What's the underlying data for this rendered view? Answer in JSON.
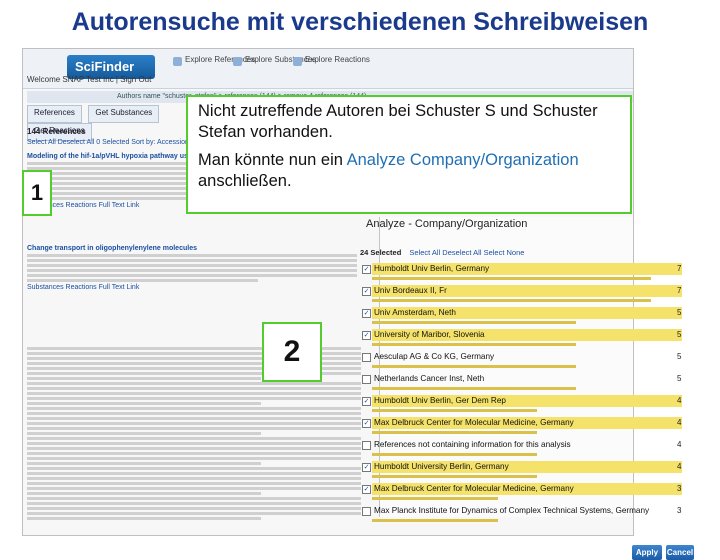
{
  "slide": {
    "title": "Autorensuche mit verschiedenen Schreibweisen"
  },
  "app": {
    "logo": "SciFinder",
    "nav": [
      {
        "icon": "references-icon",
        "label": "Explore References"
      },
      {
        "icon": "substances-icon",
        "label": "Explore Substances"
      },
      {
        "icon": "reactions-icon",
        "label": "Explore Reactions"
      }
    ],
    "welcome": "Welcome SNAP Test Inc | Sign Out",
    "breadcrumb": "Authors name \"schuster, stefan\" > references (144) > remove 4 references (144)",
    "tabs": [
      "References",
      "Get Substances",
      "Get Reactions"
    ],
    "result_count": "144 References",
    "select_links": "Select All  Deselect All  0 Selected  Sort by: Accession Number"
  },
  "results": [
    {
      "num": "1",
      "title": "Modeling of the hif-1a/pVHL hypoxia pathway using...",
      "act": "Substances  Reactions  Full Text  Link"
    },
    {
      "num": "2",
      "title": "Change transport in oligophenylenylene molecules",
      "act": "Substances  Reactions  Full Text  Link"
    }
  ],
  "callout": {
    "line1": "Nicht zutreffende Autoren bei Schuster S und Schuster Stefan vorhanden.",
    "line2_prefix": "Man könnte nun ein ",
    "line2_link": "Analyze Company/Organization",
    "line2_suffix": " anschließen."
  },
  "markers": {
    "one": "1",
    "two": "2"
  },
  "analyze": {
    "title": "Analyze - Company/Organization",
    "select_bar_count": "24 Selected",
    "select_bar_links": "Select All   Deselect All   Select None",
    "rows": [
      {
        "checked": true,
        "label": "Humboldt Univ Berlin, Germany",
        "count": "7",
        "bar": 0.93
      },
      {
        "checked": true,
        "label": "Univ Bordeaux II, Fr",
        "count": "7",
        "bar": 0.93
      },
      {
        "checked": true,
        "label": "Univ Amsterdam, Neth",
        "count": "5",
        "bar": 0.68
      },
      {
        "checked": true,
        "label": "University of Maribor, Slovenia",
        "count": "5",
        "bar": 0.68
      },
      {
        "checked": false,
        "label": "Aesculap AG & Co KG, Germany",
        "count": "5",
        "bar": 0.68
      },
      {
        "checked": false,
        "label": "Netherlands Cancer Inst, Neth",
        "count": "5",
        "bar": 0.68
      },
      {
        "checked": true,
        "label": "Humboldt Univ Berlin, Ger Dem Rep",
        "count": "4",
        "bar": 0.55
      },
      {
        "checked": true,
        "label": "Max Delbruck Center for Molecular Medicine, Germany",
        "count": "4",
        "bar": 0.55
      },
      {
        "checked": false,
        "label": "References not containing information for this analysis",
        "count": "4",
        "bar": 0.55
      },
      {
        "checked": true,
        "label": "Humboldt University Berlin, Germany",
        "count": "4",
        "bar": 0.55
      },
      {
        "checked": true,
        "label": "Max Delbruck Center for Molecular Medicine, Germany",
        "count": "3",
        "bar": 0.42
      },
      {
        "checked": false,
        "label": "Max Planck Institute for Dynamics of Complex Technical Systems, Germany",
        "count": "3",
        "bar": 0.42
      }
    ],
    "apply_label": "Apply",
    "cancel_label": "Cancel",
    "highlight_color": "#f4e26a"
  }
}
